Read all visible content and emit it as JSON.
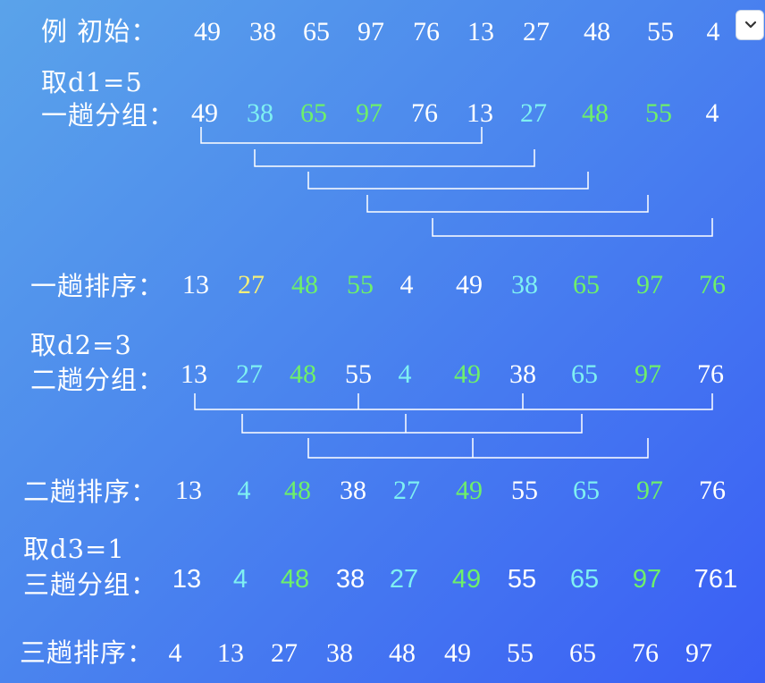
{
  "example": {
    "label": "例  初始：",
    "values": [
      "49",
      "38",
      "65",
      "97",
      "76",
      "13",
      "27",
      "48",
      "55",
      "4"
    ]
  },
  "d1": {
    "title": "取d1=5",
    "group_label": "一趟分组：",
    "group_values": [
      "49",
      "38",
      "65",
      "97",
      "76",
      "13",
      "27",
      "48",
      "55",
      "4"
    ],
    "sort_label": "一趟排序：",
    "sort_values": [
      "13",
      "27",
      "48",
      "55",
      "4",
      "49",
      "38",
      "65",
      "97",
      "76"
    ]
  },
  "d2": {
    "title": "取d2=3",
    "group_label": "二趟分组：",
    "group_values": [
      "13",
      "27",
      "48",
      "55",
      "4",
      "49",
      "38",
      "65",
      "97",
      "76"
    ],
    "sort_label": "二趟排序：",
    "sort_values": [
      "13",
      "4",
      "48",
      "38",
      "27",
      "49",
      "55",
      "65",
      "97",
      "76"
    ]
  },
  "d3": {
    "title": "取d3=1",
    "group_label": "三趟分组：",
    "group_values": [
      "13",
      "4",
      "48",
      "38",
      "27",
      "49",
      "55",
      "65",
      "97",
      "761"
    ],
    "sort_label": "三趟排序：",
    "sort_values": [
      "4",
      "13",
      "27",
      "38",
      "48",
      "49",
      "55",
      "65",
      "76",
      "97"
    ]
  },
  "colors": {
    "white": "#ffffff",
    "cyan": "#7ff0f2",
    "green": "#6ef06a",
    "yellow": "#f3ef7a"
  },
  "dropdown": {
    "icon": "chevron-down-icon"
  }
}
